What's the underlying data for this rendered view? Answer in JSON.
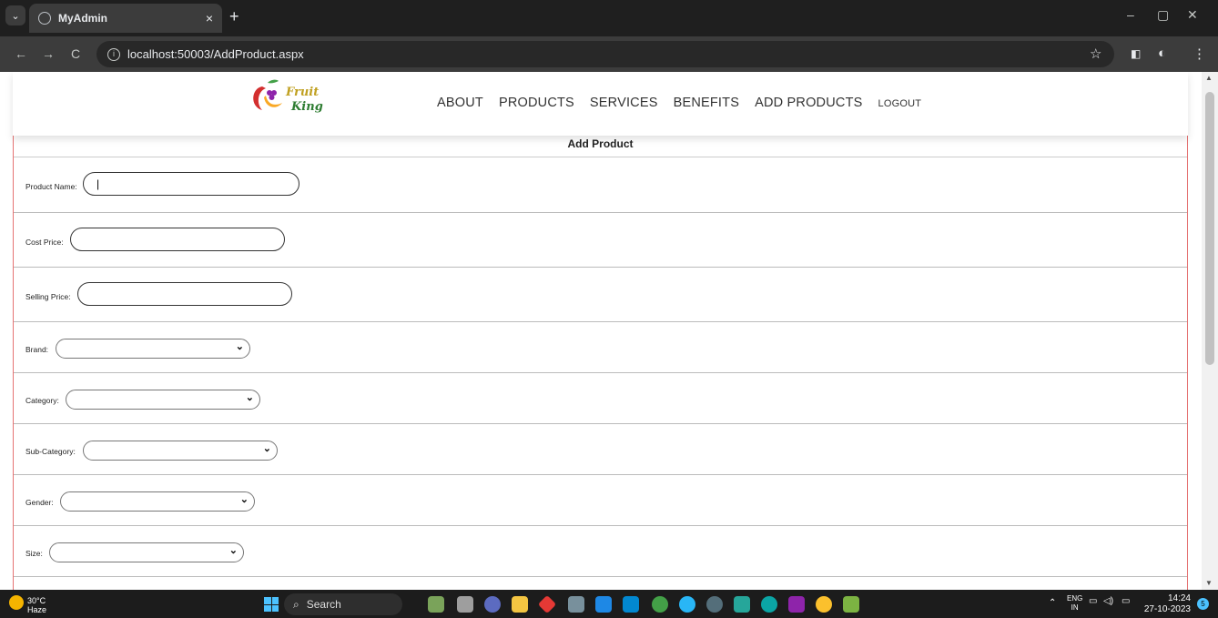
{
  "browser": {
    "tab_title": "MyAdmin",
    "tab_close": "×",
    "new_tab": "+",
    "url": "localhost:50003/AddProduct.aspx",
    "back": "←",
    "forward": "→",
    "reload": "C",
    "star": "☆",
    "min": "–",
    "max": "▢",
    "close": "✕",
    "menu": "⋮"
  },
  "site": {
    "nav": [
      "ABOUT",
      "PRODUCTS",
      "SERVICES",
      "BENEFITS",
      "ADD PRODUCTS",
      "LOGOUT"
    ]
  },
  "form": {
    "title": "Add Product",
    "fields": [
      {
        "label": "Product Name:",
        "type": "text",
        "value": "|"
      },
      {
        "label": "Cost Price:",
        "type": "text",
        "value": ""
      },
      {
        "label": "Selling Price:",
        "type": "text",
        "value": ""
      },
      {
        "label": "Brand:",
        "type": "select",
        "value": ""
      },
      {
        "label": "Category:",
        "type": "select",
        "value": ""
      },
      {
        "label": "Sub-Category:",
        "type": "select",
        "value": ""
      },
      {
        "label": "Gender:",
        "type": "select",
        "value": ""
      },
      {
        "label": "Size:",
        "type": "select",
        "value": ""
      }
    ]
  },
  "taskbar": {
    "temp": "30°C",
    "condition": "Haze",
    "search": "Search",
    "lang_top": "ENG",
    "lang_bottom": "IN",
    "time": "14:24",
    "date": "27-10-2023",
    "notif_count": "5"
  },
  "colors": {
    "form_border": "#e57373",
    "accent": "#4cc2ff"
  }
}
